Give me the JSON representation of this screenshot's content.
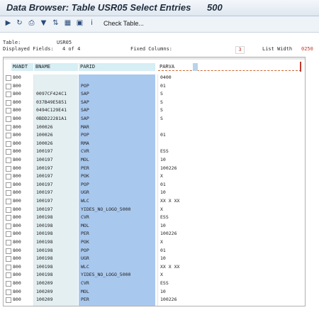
{
  "title": {
    "text": "Data Browser: Table USR05 Select Entries",
    "count": "500"
  },
  "toolbar": {
    "icons": [
      "execute-icon",
      "refresh-icon",
      "print-icon",
      "filter-icon",
      "sort-icon",
      "layout-icon",
      "export-icon",
      "info-icon"
    ],
    "check_table_label": "Check Table..."
  },
  "info": {
    "table_label": "Table:",
    "table_value": "USR05",
    "displayed_label": "Displayed Fields:",
    "displayed_value": "4 of  4",
    "fixed_label": "Fixed Columns:",
    "fixed_value": "3",
    "width_label": "List Width",
    "width_value": "0250"
  },
  "grid": {
    "headers": [
      "MANDT",
      "BNAME",
      "PARID",
      "PARVA"
    ],
    "rows": [
      [
        "800",
        "",
        "",
        "0400"
      ],
      [
        "800",
        "",
        "POP",
        "01"
      ],
      [
        "800",
        "0097CF424C1",
        "SAP",
        "S"
      ],
      [
        "800",
        "037B49E5851",
        "SAP",
        "S"
      ],
      [
        "800",
        "0494C129E41",
        "SAP",
        "S"
      ],
      [
        "800",
        "0BDD22281A1",
        "SAP",
        "S"
      ],
      [
        "800",
        "100026",
        "MAR",
        ""
      ],
      [
        "800",
        "100026",
        "POP",
        "01"
      ],
      [
        "800",
        "100026",
        "RMA",
        ""
      ],
      [
        "800",
        "100197",
        "CVR",
        "ESS"
      ],
      [
        "800",
        "100197",
        "MOL",
        "10"
      ],
      [
        "800",
        "100197",
        "PER",
        "100226"
      ],
      [
        "800",
        "100197",
        "POK",
        "X"
      ],
      [
        "800",
        "100197",
        "POP",
        "01"
      ],
      [
        "800",
        "100197",
        "UGR",
        "10"
      ],
      [
        "800",
        "100197",
        "WLC",
        "XX  X  XX"
      ],
      [
        "800",
        "100197",
        "YIDES_NO_LOGO_5000",
        "X"
      ],
      [
        "800",
        "100198",
        "CVR",
        "ESS"
      ],
      [
        "800",
        "100198",
        "MOL",
        "10"
      ],
      [
        "800",
        "100198",
        "PER",
        "100226"
      ],
      [
        "800",
        "100198",
        "POK",
        "X"
      ],
      [
        "800",
        "100198",
        "POP",
        "01"
      ],
      [
        "800",
        "100198",
        "UGR",
        "10"
      ],
      [
        "800",
        "100198",
        "WLC",
        "XX  X  XX"
      ],
      [
        "800",
        "100198",
        "YIDES_NO_LOGO_5000",
        "X"
      ],
      [
        "800",
        "100209",
        "CVR",
        "ESS"
      ],
      [
        "800",
        "100209",
        "MOL",
        "10"
      ],
      [
        "800",
        "100209",
        "PER",
        "100226"
      ]
    ]
  },
  "colors": {
    "accent": "#c0392b",
    "header_bg": "#d6eef4",
    "parid_bg": "#a9c8ee"
  }
}
